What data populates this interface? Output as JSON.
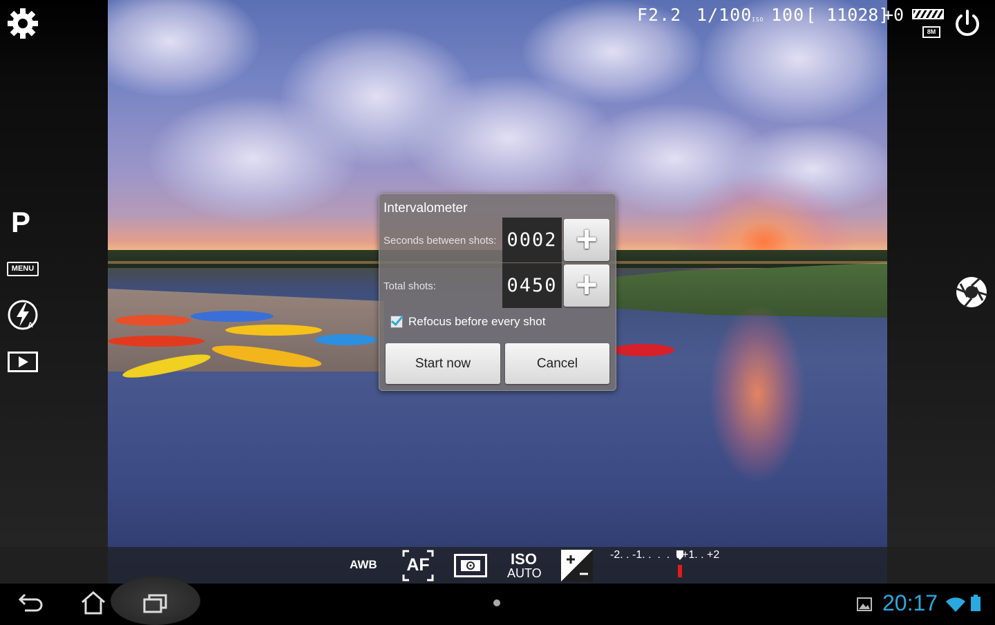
{
  "hud": {
    "aperture": "F2.2",
    "shutter": "1/100",
    "iso_label": "ISO",
    "iso_value": "100",
    "shots_remaining": "[ 11028]",
    "exposure_comp": "+0",
    "storage_badge": "8M"
  },
  "left_sidebar": {
    "mode_label": "P",
    "menu_label": "MENU",
    "icons": [
      "gear-icon",
      "flash-auto-icon",
      "play-icon"
    ]
  },
  "dialog": {
    "title": "Intervalometer",
    "seconds_label": "Seconds between shots:",
    "seconds_value": "0002",
    "total_label": "Total shots:",
    "total_value": "0450",
    "plus_symbol": "+",
    "refocus_label": "Refocus before every shot",
    "refocus_checked": true,
    "start_label": "Start now",
    "cancel_label": "Cancel"
  },
  "toolbar": {
    "awb_label": "AWB",
    "af_label": "AF",
    "iso_top": "ISO",
    "iso_bottom": "AUTO",
    "ev_scale": "-2. . -1. .  .  .  . +1. . +2"
  },
  "status": {
    "clock": "20:17"
  },
  "colors": {
    "accent_blue": "#29a9e0",
    "ev_marker": "#e21b1b"
  }
}
